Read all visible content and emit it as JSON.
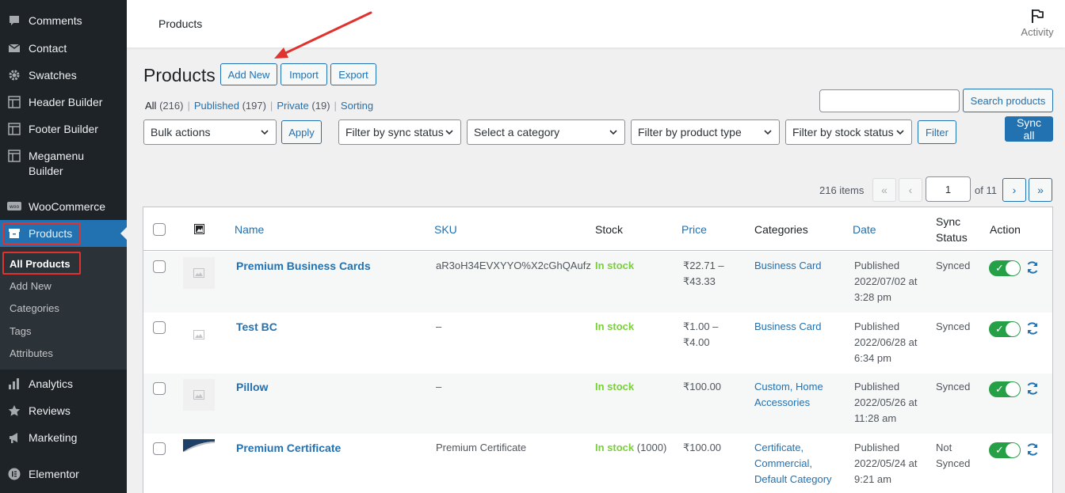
{
  "sidebar": {
    "items": [
      {
        "label": "Comments",
        "icon": "comment-icon"
      },
      {
        "label": "Contact",
        "icon": "mail-icon"
      },
      {
        "label": "Swatches",
        "icon": "gear-icon"
      },
      {
        "label": "Header Builder",
        "icon": "layout-icon"
      },
      {
        "label": "Footer Builder",
        "icon": "layout-icon"
      },
      {
        "label": "Megamenu Builder",
        "icon": "layout-icon"
      },
      {
        "label": "WooCommerce",
        "icon": "woo-icon"
      },
      {
        "label": "Products",
        "icon": "archive-icon"
      },
      {
        "label": "Analytics",
        "icon": "chart-bars-icon"
      },
      {
        "label": "Reviews",
        "icon": "star-icon"
      },
      {
        "label": "Marketing",
        "icon": "megaphone-icon"
      },
      {
        "label": "Elementor",
        "icon": "elementor-icon"
      }
    ],
    "submenu": [
      "All Products",
      "Add New",
      "Categories",
      "Tags",
      "Attributes"
    ]
  },
  "topbar": {
    "breadcrumb": "Products",
    "activity": "Activity"
  },
  "header": {
    "title": "Products",
    "add_new": "Add New",
    "import": "Import",
    "export": "Export"
  },
  "filters_status": {
    "all": "All",
    "all_count": "(216)",
    "published": "Published",
    "published_count": "(197)",
    "private": "Private",
    "private_count": "(19)",
    "sorting": "Sorting",
    "separator": "|"
  },
  "search": {
    "value": "",
    "button": "Search products",
    "sync_all": "Sync all"
  },
  "filters": {
    "bulk_actions": "Bulk actions",
    "apply": "Apply",
    "sync_status": "Filter by sync status",
    "category": "Select a category",
    "product_type": "Filter by product type",
    "stock_status": "Filter by stock status",
    "filter": "Filter"
  },
  "pagination": {
    "items": "216 items",
    "first": "«",
    "prev": "‹",
    "current": "1",
    "of": "of 11",
    "next": "›",
    "last": "»"
  },
  "table": {
    "columns": {
      "name": "Name",
      "sku": "SKU",
      "stock": "Stock",
      "price": "Price",
      "categories": "Categories",
      "date": "Date",
      "sync_status_1": "Sync",
      "sync_status_2": "Status",
      "action": "Action"
    },
    "rows": [
      {
        "name": "Premium Business Cards",
        "sku": "aR3oH34EVXYYO%X2cGhQAufz",
        "stock": "In stock",
        "stock_qty": "",
        "price1": "₹22.71 –",
        "price2": "₹43.33",
        "cat1": "Business Card",
        "cat2": "",
        "cat3": "",
        "date1": "Published",
        "date2": "2022/07/02 at",
        "date3": "3:28 pm",
        "sync1": "Synced",
        "sync2": ""
      },
      {
        "name": "Test BC",
        "sku": "–",
        "stock": "In stock",
        "stock_qty": "",
        "price1": "₹1.00 –",
        "price2": "₹4.00",
        "cat1": "Business Card",
        "cat2": "",
        "cat3": "",
        "date1": "Published",
        "date2": "2022/06/28 at",
        "date3": "6:34 pm",
        "sync1": "Synced",
        "sync2": ""
      },
      {
        "name": "Pillow",
        "sku": "–",
        "stock": "In stock",
        "stock_qty": "",
        "price1": "₹100.00",
        "price2": "",
        "cat1": "Custom, Home",
        "cat2": "Accessories",
        "cat3": "",
        "date1": "Published",
        "date2": "2022/05/26 at",
        "date3": "11:28 am",
        "sync1": "Synced",
        "sync2": ""
      },
      {
        "name": "Premium Certificate",
        "sku": "Premium Certificate",
        "stock": "In stock",
        "stock_qty": "(1000)",
        "price1": "₹100.00",
        "price2": "",
        "cat1": "Certificate,",
        "cat2": "Commercial,",
        "cat3": "Default Category",
        "date1": "Published",
        "date2": "2022/05/24 at",
        "date3": "9:21 am",
        "sync1": "Not",
        "sync2": "Synced"
      }
    ]
  },
  "colors": {
    "accent": "#2271b1",
    "sidebar": "#1d2327",
    "instock": "#7ad03a",
    "toggle_on": "#26a046",
    "highlight": "#e0322e"
  }
}
